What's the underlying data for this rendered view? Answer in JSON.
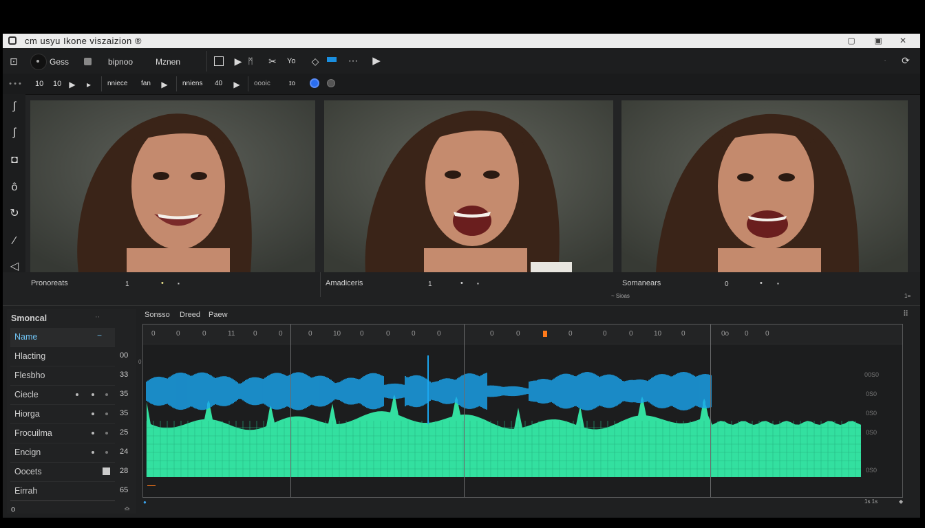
{
  "window": {
    "title": "cm  usyu  Ikone viszaizion ®",
    "controls": [
      "▢",
      "▣",
      "✕"
    ]
  },
  "toolbar": {
    "tab1": "Gess",
    "tab2": "bipnoo",
    "tab3": "Mznen",
    "btn_a": "Yo"
  },
  "toolbar2": {
    "num1": "10",
    "num2": "10",
    "label1": "nniece",
    "label2": "fan",
    "label3": "nniens",
    "label4": "40",
    "label5": "oooic",
    "label6": "ɪo"
  },
  "frames": [
    {
      "caption": "Pronoreats",
      "num": "1",
      "extra": "•",
      "extra2": "▪"
    },
    {
      "caption": "Amadiceris",
      "num": "1",
      "extra": "•",
      "extra2": "▪"
    },
    {
      "caption": "Somanears",
      "num": "0",
      "extra": "•",
      "extra2": "▪"
    }
  ],
  "status": {
    "center": "~ Sioas",
    "right": "1="
  },
  "sidepanel": {
    "header": "Smoncal",
    "header_icon": "··",
    "items": [
      {
        "label": "Name",
        "value": ""
      },
      {
        "label": "Hlacting",
        "value": "00"
      },
      {
        "label": "Flesbho",
        "value": "33"
      },
      {
        "label": "Ciecle",
        "value": "35"
      },
      {
        "label": "Hiorga",
        "value": "35"
      },
      {
        "label": "Frocuilma",
        "value": "25"
      },
      {
        "label": "Encign",
        "value": "24"
      },
      {
        "label": "Oocets",
        "value": "28"
      },
      {
        "label": "Eirrah",
        "value": "65"
      }
    ],
    "footer": "o",
    "footer_right": "≏"
  },
  "timeline": {
    "tabs": [
      "Sonsso",
      "Dreed",
      "Paew"
    ],
    "ticks": [
      "0",
      "0",
      "0",
      "11",
      "0",
      "0",
      "0",
      "10",
      "0",
      "0",
      "0",
      "0",
      "0",
      "0",
      "0",
      "0",
      "0",
      "10",
      "0",
      "0o",
      "0",
      "0"
    ],
    "right_labels": [
      "00S0",
      "0S0",
      "0S0",
      "0S0",
      "0S0"
    ],
    "playhead_color": "#ff7a1a",
    "blue_color": "#1aa7f0",
    "green_color": "#33e0a0",
    "bottom_right": "1s  1s"
  },
  "icons": {
    "side": [
      "lasso-icon",
      "curve-icon",
      "shield-icon",
      "drop-icon",
      "rotate-icon",
      "brush-icon",
      "send-icon"
    ]
  }
}
